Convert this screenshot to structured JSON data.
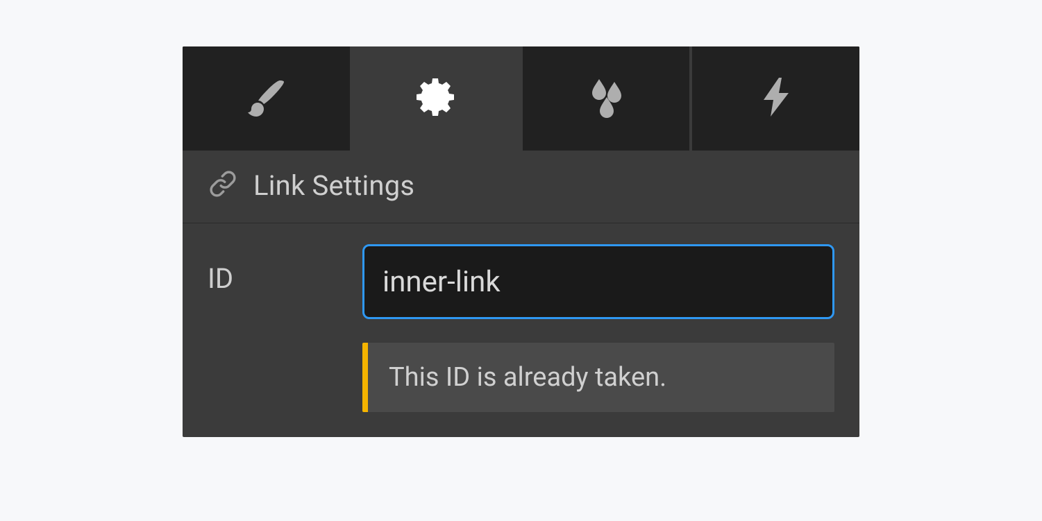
{
  "tabs": {
    "style_icon": "brush-icon",
    "settings_icon": "gear-icon",
    "effects_icon": "droplets-icon",
    "interactions_icon": "bolt-icon"
  },
  "section": {
    "title": "Link Settings"
  },
  "form": {
    "id_label": "ID",
    "id_value": "inner-link",
    "id_warning": "This ID is already taken."
  }
}
